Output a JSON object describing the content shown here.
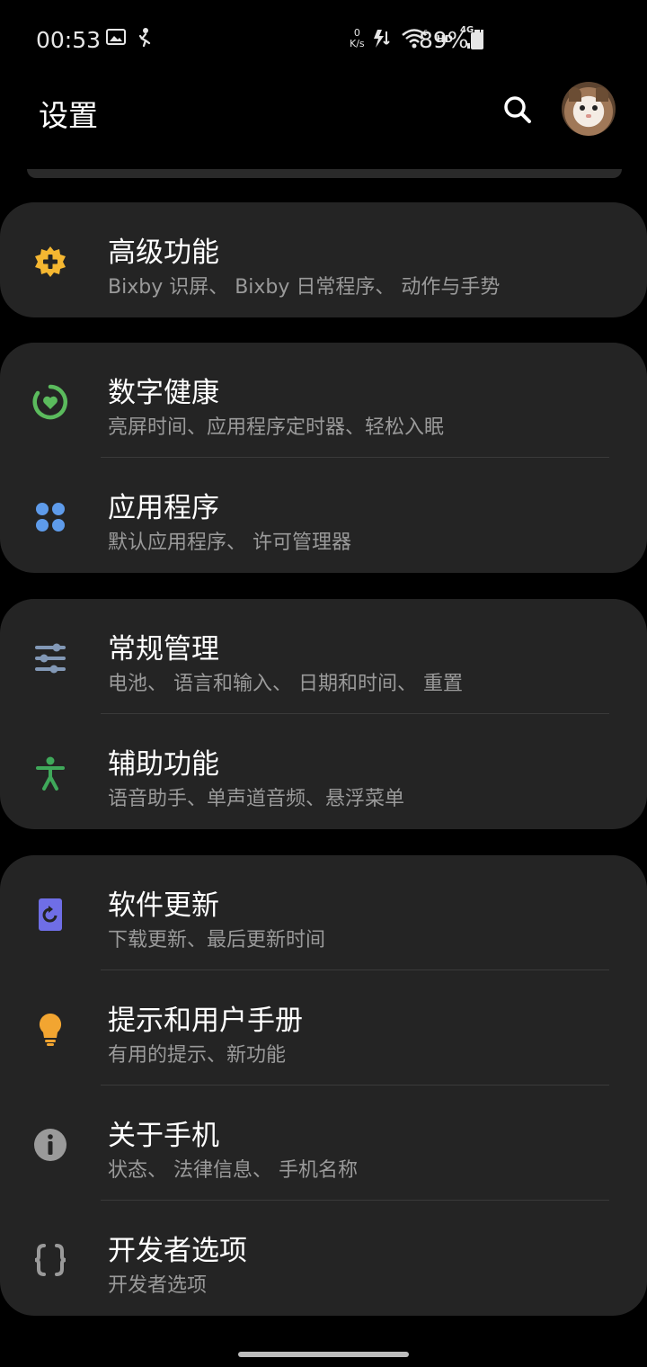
{
  "status_bar": {
    "time": "00:53",
    "net_speed_value": "0",
    "net_speed_unit": "K/s",
    "hd": "HD",
    "network": "4G",
    "battery": "89%"
  },
  "header": {
    "title": "设置",
    "search_icon": "search-icon",
    "avatar_icon": "user-avatar"
  },
  "cards": [
    {
      "items": [
        {
          "title": "高级功能",
          "subtitle": "Bixby 识屏、 Bixby 日常程序、 动作与手势",
          "icon": "advanced-features-icon",
          "icon_color": "#f5b731"
        }
      ]
    },
    {
      "items": [
        {
          "title": "数字健康",
          "subtitle": "亮屏时间、应用程序定时器、轻松入眠",
          "icon": "digital-wellbeing-icon",
          "icon_color": "#5bbb5d"
        },
        {
          "title": "应用程序",
          "subtitle": "默认应用程序、 许可管理器",
          "icon": "apps-icon",
          "icon_color": "#5e9bea"
        }
      ]
    },
    {
      "items": [
        {
          "title": "常规管理",
          "subtitle": "电池、 语言和输入、 日期和时间、 重置",
          "icon": "general-management-icon",
          "icon_color": "#8298b6"
        },
        {
          "title": "辅助功能",
          "subtitle": "语音助手、单声道音频、悬浮菜单",
          "icon": "accessibility-icon",
          "icon_color": "#3fa85a"
        }
      ]
    },
    {
      "items": [
        {
          "title": "软件更新",
          "subtitle": "下载更新、最后更新时间",
          "icon": "software-update-icon",
          "icon_color": "#6f6ee6"
        },
        {
          "title": "提示和用户手册",
          "subtitle": "有用的提示、新功能",
          "icon": "tips-lightbulb-icon",
          "icon_color": "#f2a531"
        },
        {
          "title": "关于手机",
          "subtitle": "状态、 法律信息、 手机名称",
          "icon": "about-phone-info-icon",
          "icon_color": "#9a9a9a"
        },
        {
          "title": "开发者选项",
          "subtitle": "开发者选项",
          "icon": "developer-options-icon",
          "icon_color": "#9a9a9a"
        }
      ]
    }
  ]
}
